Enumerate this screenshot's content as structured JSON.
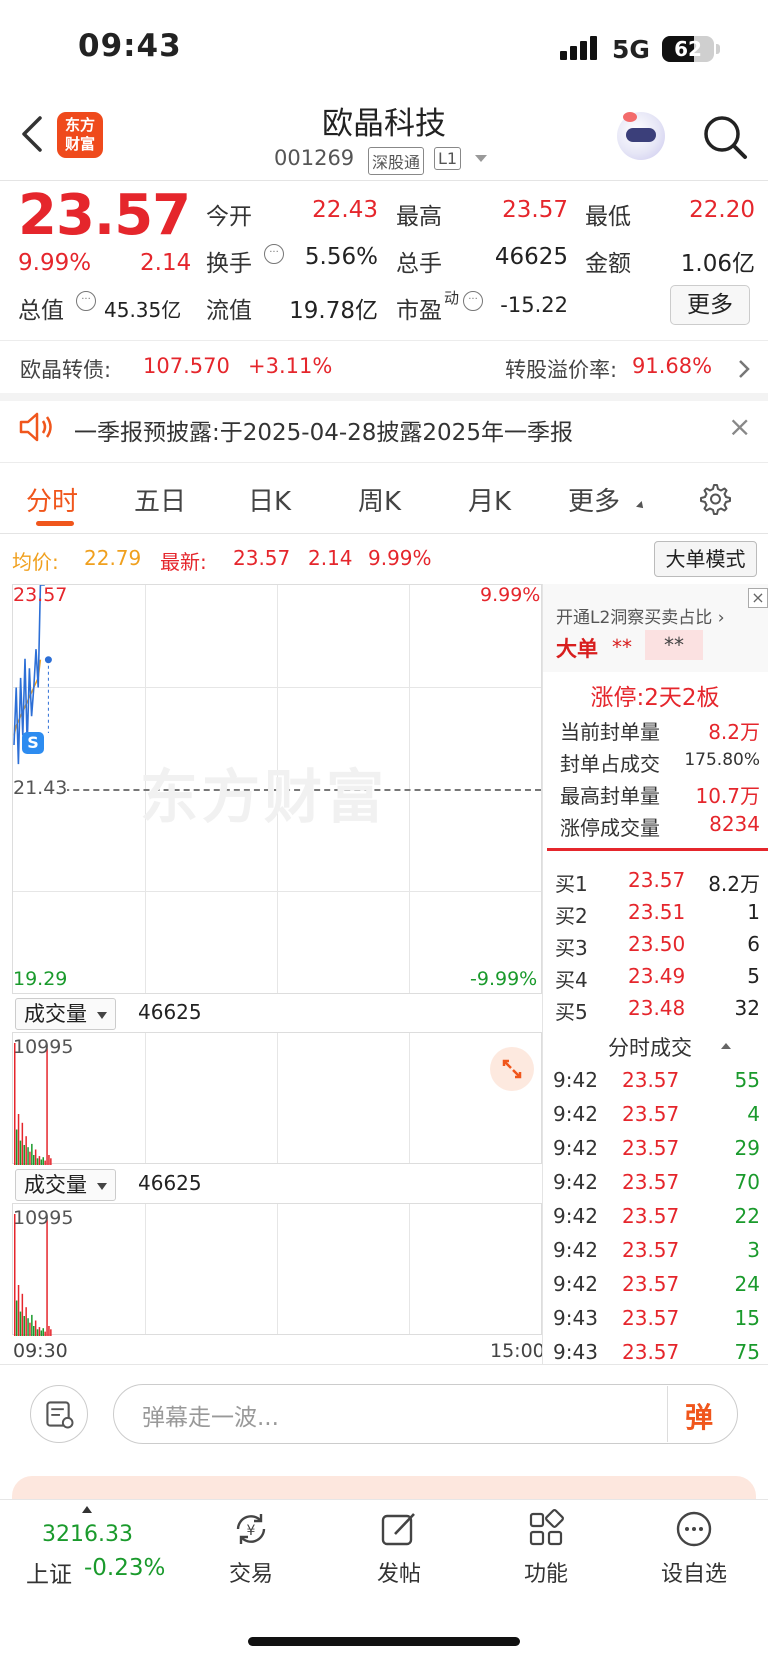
{
  "status_bar": {
    "time": "09:43",
    "network": "5G",
    "battery": "62",
    "battery_level": 0.62
  },
  "header": {
    "title": "欧晶科技",
    "code": "001269",
    "tag_connect": "深股通",
    "tag_level": "L1",
    "logo_text_line1": "东方",
    "logo_text_line2": "财富"
  },
  "quote": {
    "price": "23.57",
    "pct": "9.99%",
    "change": "2.14",
    "stats": [
      {
        "label": "今开",
        "value": "22.43",
        "color": "red"
      },
      {
        "label": "最高",
        "value": "23.57",
        "color": "red"
      },
      {
        "label": "最低",
        "value": "22.20",
        "color": "red"
      },
      {
        "label": "换手",
        "value": "5.56%",
        "color": "black"
      },
      {
        "label": "总手",
        "value": "46625",
        "color": "black"
      },
      {
        "label": "金额",
        "value": "1.06亿",
        "color": "black"
      },
      {
        "label": "总值",
        "value": "45.35亿",
        "color": "black"
      },
      {
        "label": "流值",
        "value": "19.78亿",
        "color": "black"
      },
      {
        "label": "市盈",
        "label_sup": "动",
        "value": "-15.22",
        "color": "black"
      }
    ],
    "more_label": "更多"
  },
  "bond": {
    "label": "欧晶转债:",
    "price": "107.570",
    "change": "+3.11%",
    "premium_label": "转股溢价率:",
    "premium": "91.68%"
  },
  "notice": {
    "text": "一季报预披露:于2025-04-28披露2025年一季报"
  },
  "tabs": [
    "分时",
    "五日",
    "日K",
    "周K",
    "月K",
    "更多"
  ],
  "info_line": {
    "avg_label": "均价:",
    "avg_value": "22.79",
    "last_label": "最新:",
    "last_value": "23.57",
    "last_change": "2.14",
    "last_pct": "9.99%",
    "mode_button": "大单模式"
  },
  "chart_data": {
    "type": "line",
    "price_axis": {
      "top": "23.57",
      "mid": "21.43",
      "bottom": "19.29",
      "top_pct": "9.99%",
      "bottom_pct": "-9.99%"
    },
    "x_start": "09:30",
    "x_end": "15:00",
    "price_series": [
      21.9,
      22.5,
      21.7,
      22.6,
      22.0,
      22.8,
      21.9,
      22.7,
      22.2,
      22.5,
      22.9,
      22.5,
      23.57,
      23.57,
      23.57
    ],
    "avg_series": [
      22.0,
      22.1,
      22.15,
      22.2,
      22.25,
      22.3,
      22.35,
      22.4,
      22.45,
      22.5,
      22.55,
      22.6,
      22.79
    ],
    "volume": {
      "label": "成交量",
      "total": "46625",
      "max": "10995",
      "bars": [
        {
          "v": 10995,
          "c": "red"
        },
        {
          "v": 3200,
          "c": "green"
        },
        {
          "v": 4600,
          "c": "red"
        },
        {
          "v": 2200,
          "c": "green"
        },
        {
          "v": 3800,
          "c": "red"
        },
        {
          "v": 1800,
          "c": "green"
        },
        {
          "v": 2600,
          "c": "red"
        },
        {
          "v": 1600,
          "c": "green"
        },
        {
          "v": 1200,
          "c": "red"
        },
        {
          "v": 1900,
          "c": "green"
        },
        {
          "v": 900,
          "c": "green"
        },
        {
          "v": 1400,
          "c": "red"
        },
        {
          "v": 600,
          "c": "green"
        },
        {
          "v": 800,
          "c": "red"
        },
        {
          "v": 500,
          "c": "green"
        },
        {
          "v": 700,
          "c": "green"
        },
        {
          "v": 400,
          "c": "red"
        },
        {
          "v": 10500,
          "c": "red"
        },
        {
          "v": 900,
          "c": "red"
        },
        {
          "v": 600,
          "c": "red"
        }
      ]
    },
    "volume2": {
      "label": "成交量",
      "total": "46625",
      "max": "10995"
    }
  },
  "watermark": "东方财富",
  "right_panel": {
    "title": "开通L2洞察买卖占比",
    "big_order_label": "大单",
    "stars1": "**",
    "stars2": "**",
    "limit_title": "涨停:2天2板",
    "limit_rows": [
      {
        "label": "当前封单量",
        "value": "8.2万"
      },
      {
        "label": "封单占成交",
        "value": "175.80%"
      },
      {
        "label": "最高封单量",
        "value": "10.7万"
      },
      {
        "label": "涨停成交量",
        "value": "8234"
      }
    ],
    "bids": [
      {
        "label": "买1",
        "price": "23.57",
        "vol": "8.2万"
      },
      {
        "label": "买2",
        "price": "23.51",
        "vol": "1"
      },
      {
        "label": "买3",
        "price": "23.50",
        "vol": "6"
      },
      {
        "label": "买4",
        "price": "23.49",
        "vol": "5"
      },
      {
        "label": "买5",
        "price": "23.48",
        "vol": "32"
      }
    ],
    "ticks_title": "分时成交",
    "ticks": [
      {
        "t": "9:42",
        "p": "23.57",
        "v": "55"
      },
      {
        "t": "9:42",
        "p": "23.57",
        "v": "4"
      },
      {
        "t": "9:42",
        "p": "23.57",
        "v": "29"
      },
      {
        "t": "9:42",
        "p": "23.57",
        "v": "70"
      },
      {
        "t": "9:42",
        "p": "23.57",
        "v": "22"
      },
      {
        "t": "9:42",
        "p": "23.57",
        "v": "3"
      },
      {
        "t": "9:42",
        "p": "23.57",
        "v": "24"
      },
      {
        "t": "9:43",
        "p": "23.57",
        "v": "15"
      },
      {
        "t": "9:43",
        "p": "23.57",
        "v": "75"
      }
    ]
  },
  "danmu": {
    "placeholder": "弹幕走一波...",
    "button": "弹"
  },
  "tabbar": {
    "index_value": "3216.33",
    "index_name": "上证",
    "index_pct": "-0.23%",
    "items": [
      {
        "label": "交易",
        "icon": "yuan-cycle-icon"
      },
      {
        "label": "发帖",
        "icon": "edit-icon"
      },
      {
        "label": "功能",
        "icon": "grid-icon"
      },
      {
        "label": "设自选",
        "icon": "more-dots-icon"
      }
    ]
  },
  "colors": {
    "up": "#e5262c",
    "down": "#1a9a2c",
    "accent": "#f0561c",
    "avg": "#f0a01e",
    "line": "#2d6fd6"
  }
}
